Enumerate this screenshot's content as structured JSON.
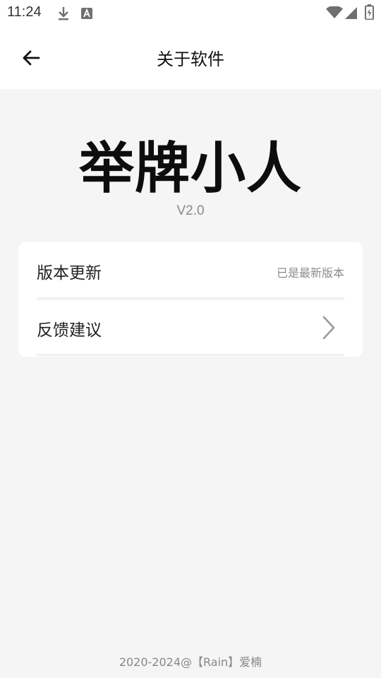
{
  "status_bar": {
    "time": "11:24",
    "icons": [
      "download-icon",
      "font-icon",
      "wifi-icon",
      "signal-icon",
      "battery-icon"
    ]
  },
  "app_bar": {
    "title": "关于软件",
    "back_icon": "arrow-left-icon"
  },
  "app_info": {
    "name": "举牌小人",
    "version": "V2.0"
  },
  "settings": {
    "update_label": "版本更新",
    "update_status": "已是最新版本",
    "feedback_label": "反馈建议",
    "feedback_icon": "chevron-right-icon"
  },
  "footer": {
    "copyright": "2020-2024@【Rain】爱楠"
  }
}
